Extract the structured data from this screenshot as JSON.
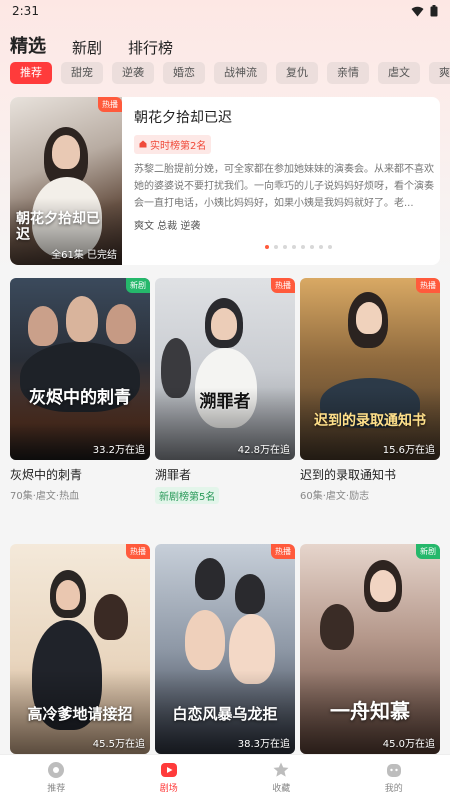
{
  "status": {
    "time": "2:31"
  },
  "top_tabs": [
    "精选",
    "新剧",
    "排行榜"
  ],
  "chips": [
    "推荐",
    "甜宠",
    "逆袭",
    "婚恋",
    "战神流",
    "复仇",
    "亲情",
    "虐文",
    "爽文"
  ],
  "featured": {
    "tag": "热播",
    "title": "朝花夕拾却已迟",
    "poster_title": "朝花夕拾却已迟",
    "rank": "实时榜第2名",
    "description": "苏黎二胎提前分娩，可全家都在参加她妹妹的演奏会。从来都不喜欢她的婆婆说不要打扰我们。一向乖巧的儿子说妈妈好烦呀，看个演奏会一直打电话，小姨比妈妈好，如果小姨是我妈妈就好了。老...",
    "tags": "爽文 总裁 逆袭",
    "episodes": "全61集 已完结",
    "carousel_dots": 8,
    "carousel_active": 0
  },
  "cards": [
    {
      "tag": "新剧",
      "tag_type": "new",
      "title": "灰烬中的刺青",
      "poster_title": "灰烬中的刺青",
      "views": "33.2万在追",
      "meta": "70集·虐文·热血",
      "rank": ""
    },
    {
      "tag": "热播",
      "tag_type": "hot",
      "title": "溯罪者",
      "poster_title": "溯罪者",
      "views": "42.8万在追",
      "meta": "",
      "rank": "新剧榜第5名"
    },
    {
      "tag": "热播",
      "tag_type": "hot",
      "title": "迟到的录取通知书",
      "poster_title": "迟到的录取通知书",
      "views": "15.6万在追",
      "meta": "60集·虐文·励志",
      "rank": ""
    },
    {
      "tag": "热播",
      "tag_type": "hot",
      "title": "",
      "poster_title": "高冷爹地请接招",
      "views": "45.5万在追",
      "meta": "",
      "rank": ""
    },
    {
      "tag": "热播",
      "tag_type": "hot",
      "title": "",
      "poster_title": "白恋风暴乌龙拒",
      "views": "38.3万在追",
      "meta": "",
      "rank": ""
    },
    {
      "tag": "新剧",
      "tag_type": "new",
      "title": "",
      "poster_title": "一舟知慕",
      "views": "45.0万在追",
      "meta": "",
      "rank": ""
    }
  ],
  "bottom_nav": [
    {
      "label": "推荐",
      "icon": "compass-icon"
    },
    {
      "label": "剧场",
      "icon": "play-icon"
    },
    {
      "label": "收藏",
      "icon": "star-icon"
    },
    {
      "label": "我的",
      "icon": "profile-icon"
    }
  ],
  "colors": {
    "accent": "#ff3b3b",
    "hot_tag": "#ff5a3c",
    "new_tag": "#25b86b"
  }
}
